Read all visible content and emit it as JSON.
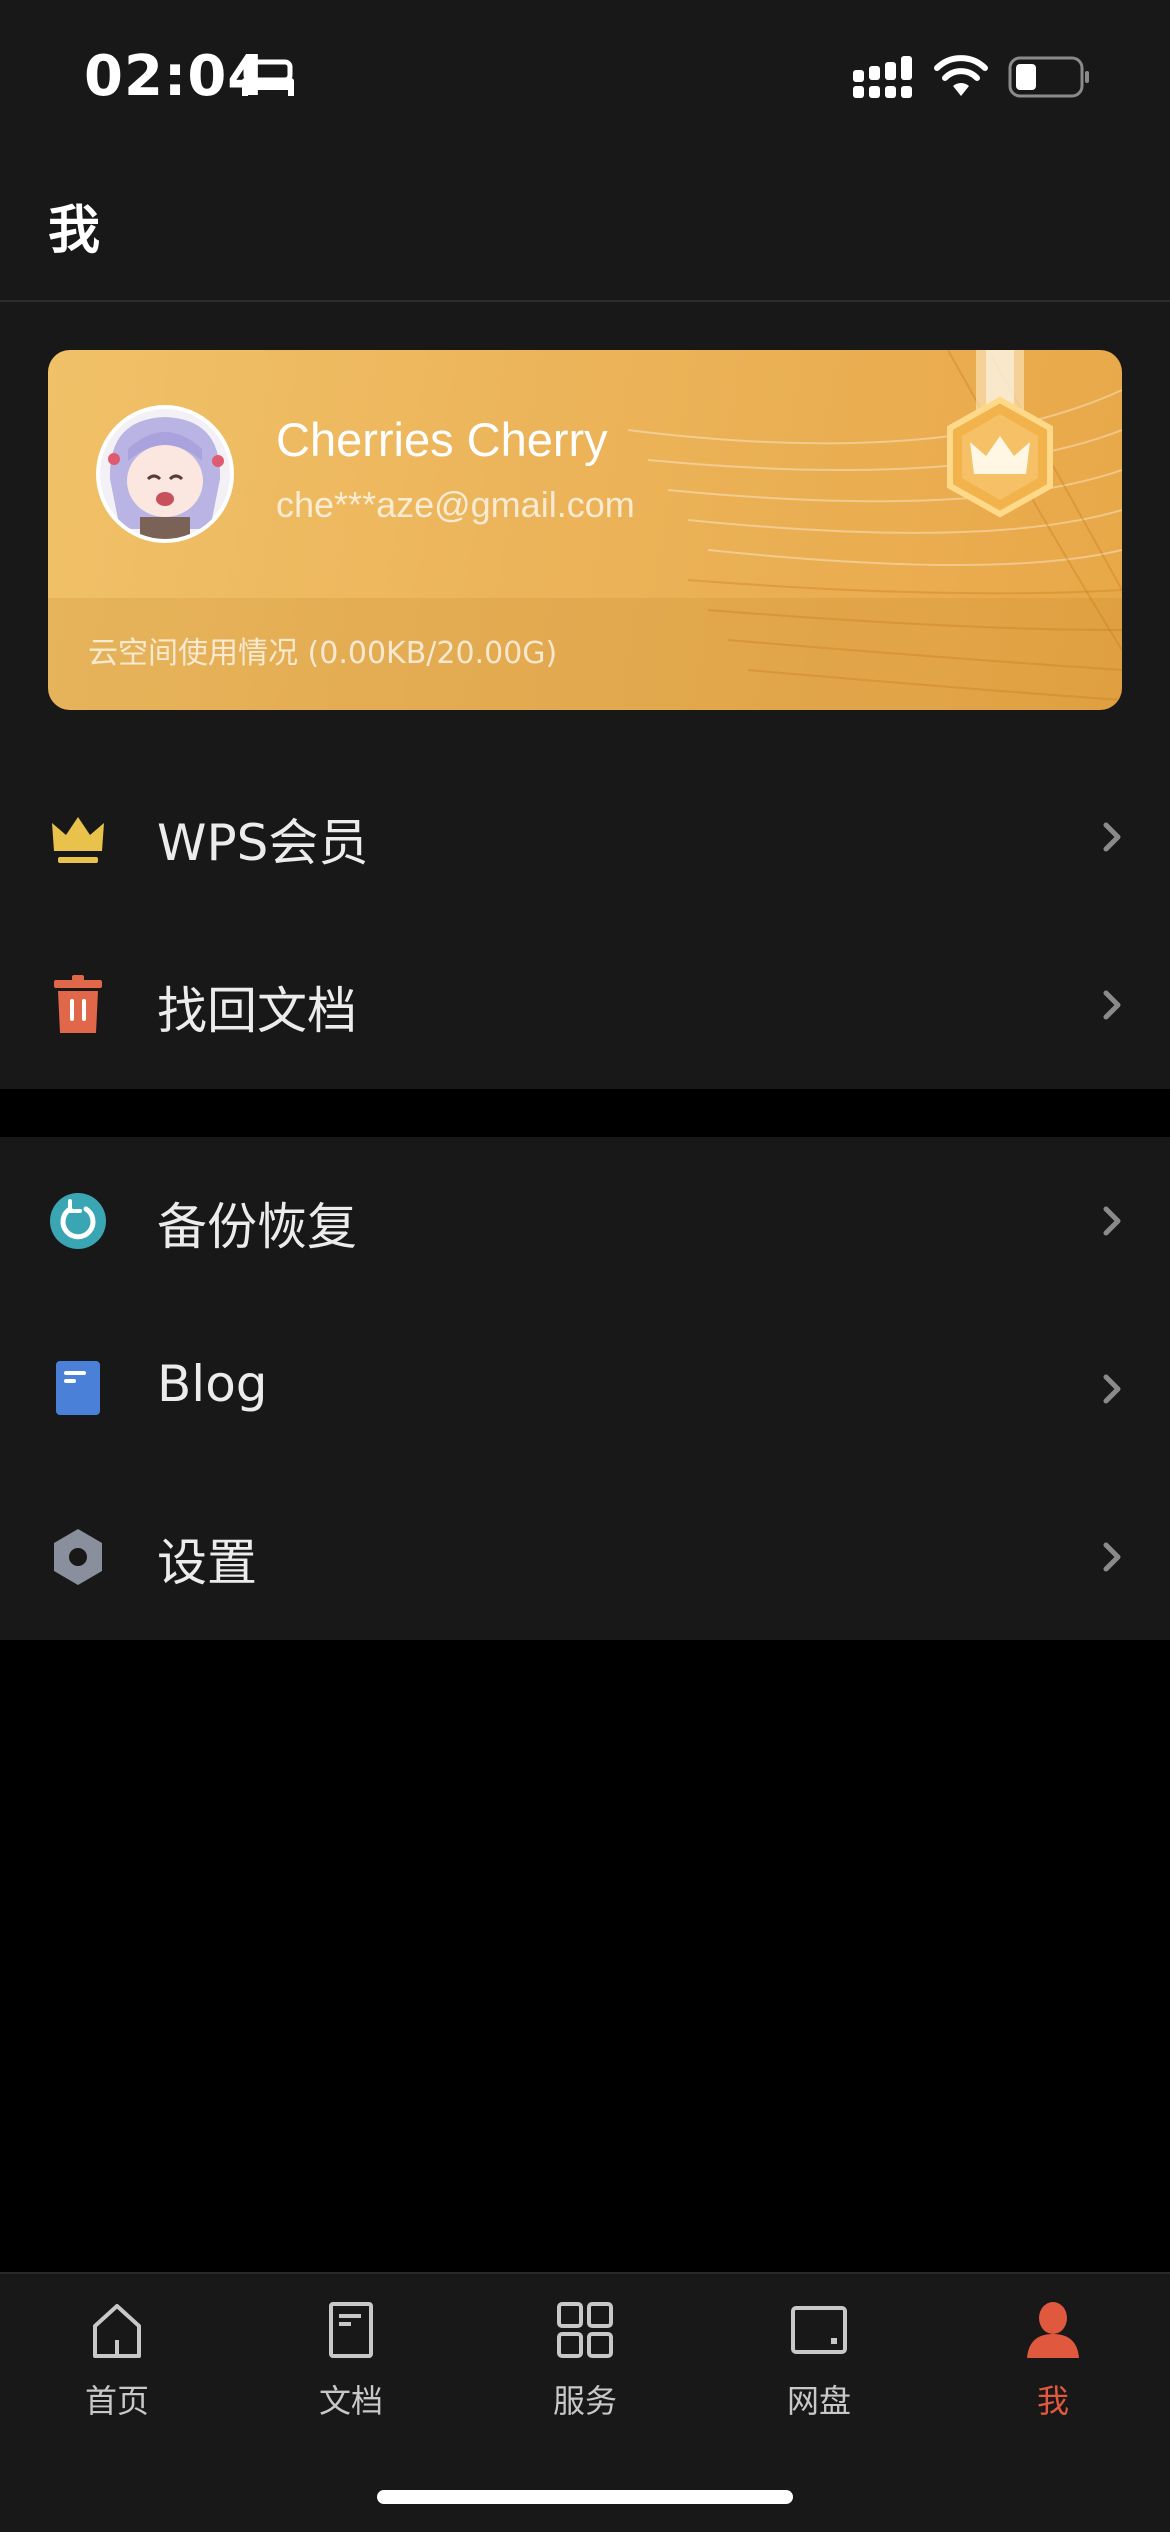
{
  "status_bar": {
    "time": "02:04"
  },
  "header": {
    "title": "我"
  },
  "profile": {
    "name": "Cherries Cherry",
    "email": "che***aze@gmail.com",
    "storage": "云空间使用情况 (0.00KB/20.00G)"
  },
  "menu_top": [
    {
      "label": "WPS会员",
      "icon": "crown-icon",
      "color": "#e8c24a"
    },
    {
      "label": "找回文档",
      "icon": "trash-icon",
      "color": "#e0674a"
    }
  ],
  "menu_bottom": [
    {
      "label": "备份恢复",
      "icon": "backup-restore-icon",
      "color": "#3aa6b4"
    },
    {
      "label": "Blog",
      "icon": "blog-icon",
      "color": "#4a80d8"
    },
    {
      "label": "设置",
      "icon": "settings-icon",
      "color": "#8a8f9e"
    }
  ],
  "tabs": [
    {
      "label": "首页",
      "icon": "home-icon"
    },
    {
      "label": "文档",
      "icon": "document-icon"
    },
    {
      "label": "服务",
      "icon": "grid-icon"
    },
    {
      "label": "网盘",
      "icon": "cloud-drive-icon"
    },
    {
      "label": "我",
      "icon": "person-icon",
      "active": true
    }
  ],
  "colors": {
    "accent": "#e0583d",
    "card": "#ecb45a",
    "background": "#181818"
  }
}
